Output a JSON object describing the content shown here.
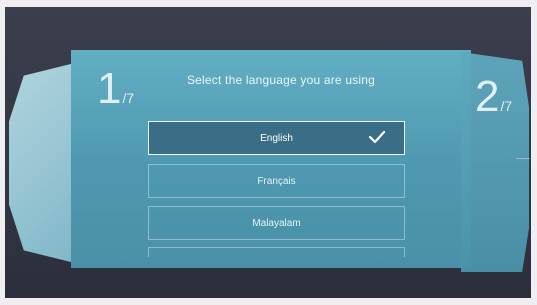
{
  "setup": {
    "title": "Select the language you are using",
    "current_step": "1",
    "total_suffix": "/7",
    "next_step": "2",
    "languages": [
      {
        "label": "English",
        "selected": true
      },
      {
        "label": "Français",
        "selected": false
      },
      {
        "label": "Malayalam",
        "selected": false
      }
    ],
    "icons": {
      "selected": "check-icon"
    }
  }
}
